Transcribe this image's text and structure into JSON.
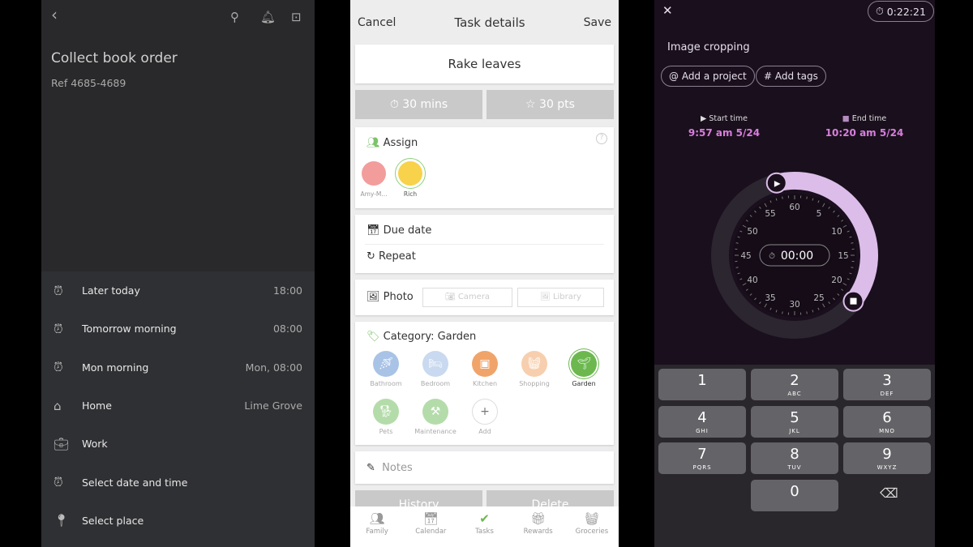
{
  "left": {
    "title": "Collect book order",
    "ref": "Ref 4685-4689",
    "items": [
      {
        "icon": "alarm",
        "label": "Later today",
        "value": "18:00"
      },
      {
        "icon": "alarm",
        "label": "Tomorrow morning",
        "value": "08:00"
      },
      {
        "icon": "alarm",
        "label": "Mon morning",
        "value": "Mon, 08:00"
      },
      {
        "icon": "home",
        "label": "Home",
        "value": "Lime Grove"
      },
      {
        "icon": "briefcase",
        "label": "Work",
        "value": ""
      },
      {
        "icon": "alarm",
        "label": "Select date and time",
        "value": ""
      },
      {
        "icon": "pin",
        "label": "Select place",
        "value": ""
      }
    ]
  },
  "mid": {
    "cancel": "Cancel",
    "title": "Task details",
    "save": "Save",
    "task": "Rake leaves",
    "duration": "30 mins",
    "points": "30 pts",
    "assign": "Assign",
    "people": [
      {
        "name": "Amy-M..."
      },
      {
        "name": "Rich"
      }
    ],
    "due": "Due date",
    "repeat": "Repeat",
    "photo": "Photo",
    "camera": "Camera",
    "library": "Library",
    "category": "Category: Garden",
    "categories": [
      {
        "name": "Bathroom",
        "color": "#a9c3e6"
      },
      {
        "name": "Bedroom",
        "color": "#c9d9ef"
      },
      {
        "name": "Kitchen",
        "color": "#f0a46a"
      },
      {
        "name": "Shopping",
        "color": "#f7cfae"
      },
      {
        "name": "Garden",
        "color": "#6cb84f"
      },
      {
        "name": "Pets",
        "color": "#b4dcaa"
      },
      {
        "name": "Maintenance",
        "color": "#b4dcaa"
      },
      {
        "name": "Add",
        "color": "#ffffff"
      }
    ],
    "notes": "Notes",
    "history": "History",
    "delete": "Delete",
    "nav": [
      "Family",
      "Calendar",
      "Tasks",
      "Rewards",
      "Groceries"
    ]
  },
  "right": {
    "timer": "0:22:21",
    "task": "Image cropping",
    "project": "@ Add a project",
    "tags": "# Add tags",
    "start_label": "Start time",
    "start": "9:57 am 5/24",
    "end_label": "End time",
    "end": "10:20 am 5/24",
    "dial_value": "00:00",
    "ticks": [
      "60",
      "5",
      "10",
      "15",
      "20",
      "25",
      "30",
      "35",
      "40",
      "45",
      "50",
      "55"
    ],
    "keys": [
      [
        "1",
        ""
      ],
      [
        "2",
        "ABC"
      ],
      [
        "3",
        "DEF"
      ],
      [
        "4",
        "GHI"
      ],
      [
        "5",
        "JKL"
      ],
      [
        "6",
        "MNO"
      ],
      [
        "7",
        "PQRS"
      ],
      [
        "8",
        "TUV"
      ],
      [
        "9",
        "WXYZ"
      ],
      [
        "0",
        ""
      ]
    ],
    "accent": "#d77fdc"
  }
}
